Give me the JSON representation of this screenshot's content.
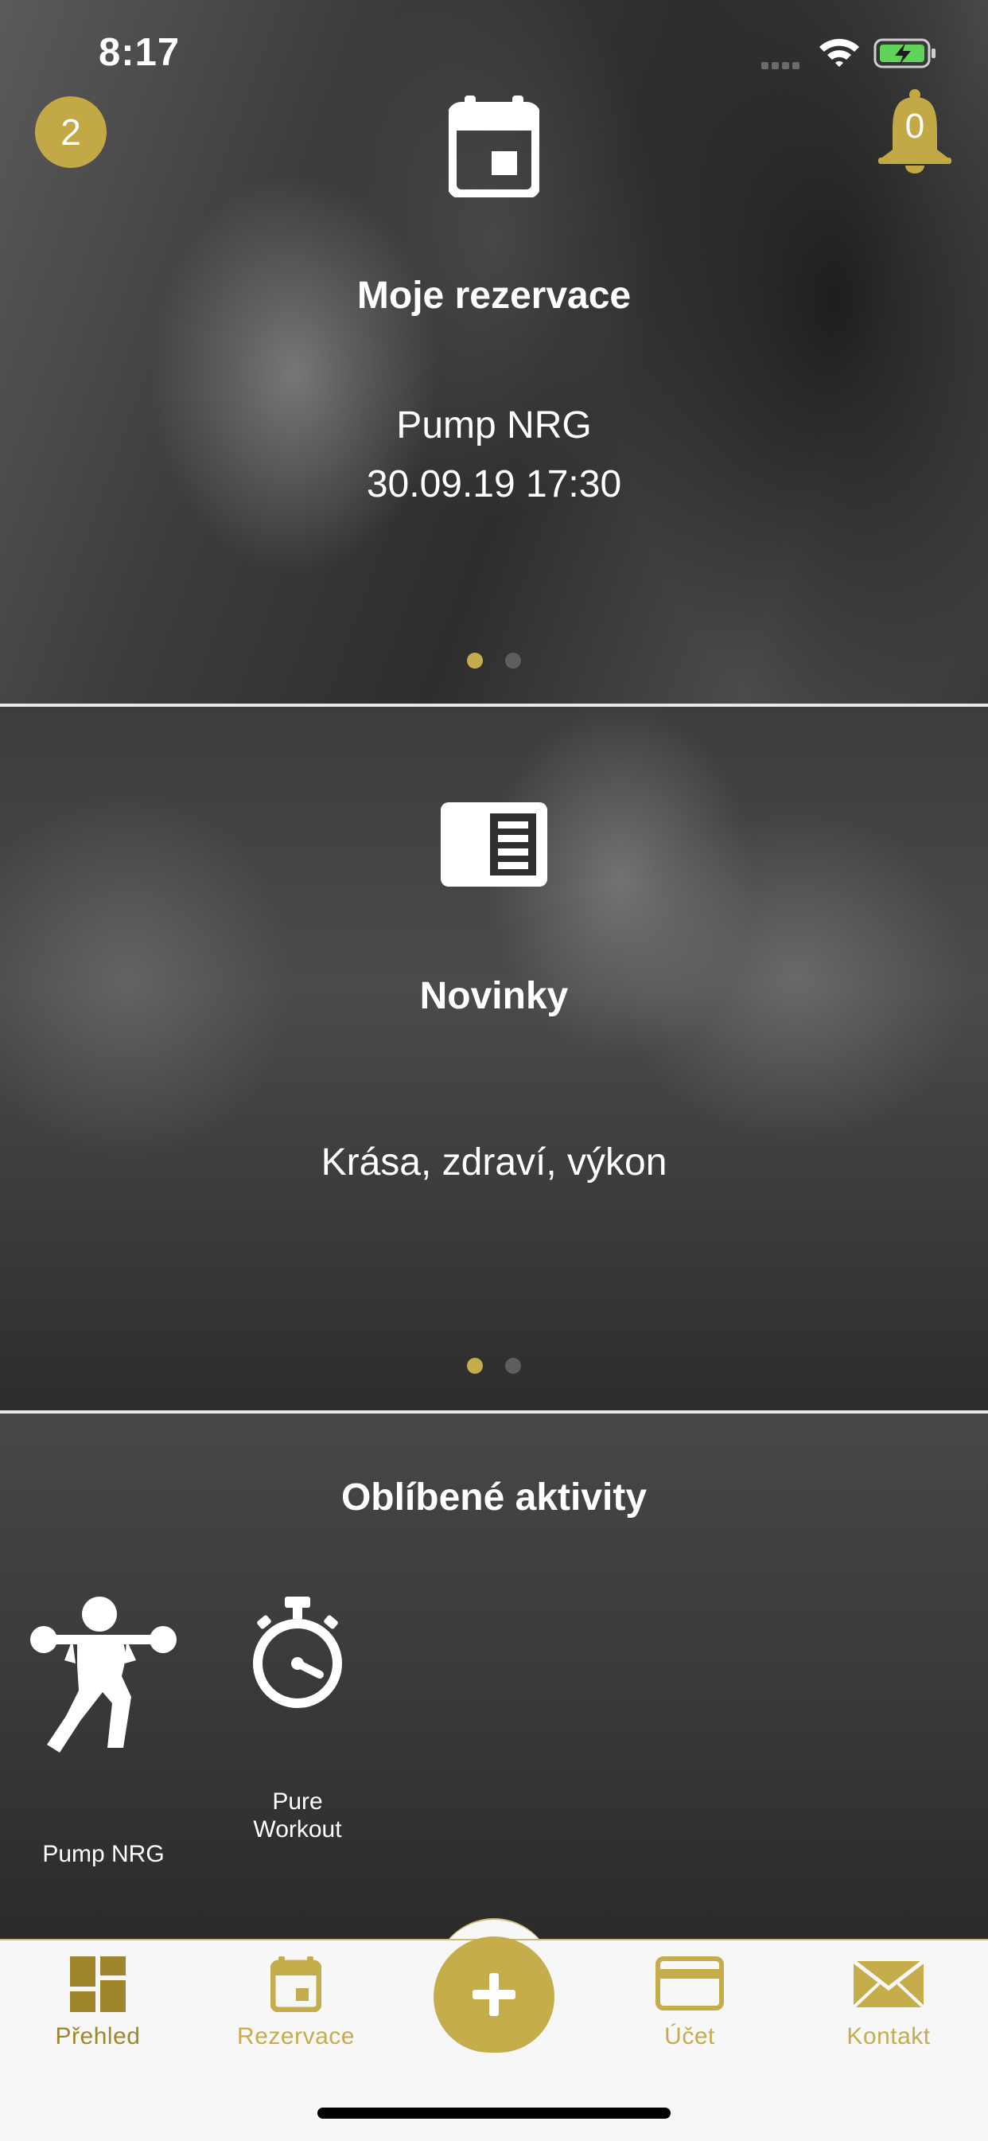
{
  "status_bar": {
    "time": "8:17"
  },
  "header": {
    "reservations_count": "2",
    "notifications_count": "0"
  },
  "reservations_panel": {
    "title": "Moje rezervace",
    "activity": "Pump NRG",
    "datetime": "30.09.19 17:30",
    "icon": "calendar-icon",
    "page_indicator": {
      "pages": 2,
      "active": 1
    }
  },
  "news_panel": {
    "title": "Novinky",
    "headline": "Krása, zdraví, výkon",
    "icon": "newspaper-icon",
    "page_indicator": {
      "pages": 2,
      "active": 1
    }
  },
  "favorites": {
    "title": "Oblíbené aktivity",
    "items": [
      {
        "label": "Pump NRG",
        "icon": "weightlifter-icon"
      },
      {
        "label_line1": "Pure",
        "label_line2": "Workout",
        "icon": "stopwatch-icon"
      }
    ]
  },
  "tabbar": {
    "items": [
      {
        "label": "Přehled",
        "icon": "dashboard-icon",
        "selected": true
      },
      {
        "label": "Rezervace",
        "icon": "calendar-icon"
      },
      {
        "label": "",
        "icon": "plus-icon"
      },
      {
        "label": "Účet",
        "icon": "credit-card-icon"
      },
      {
        "label": "Kontakt",
        "icon": "envelope-icon"
      }
    ]
  },
  "colors": {
    "accent_gold": "#c6ad4c",
    "active_tab": "#a0862b",
    "tabbar_bg": "#f7f7f7",
    "battery_green": "#5fd35a"
  }
}
